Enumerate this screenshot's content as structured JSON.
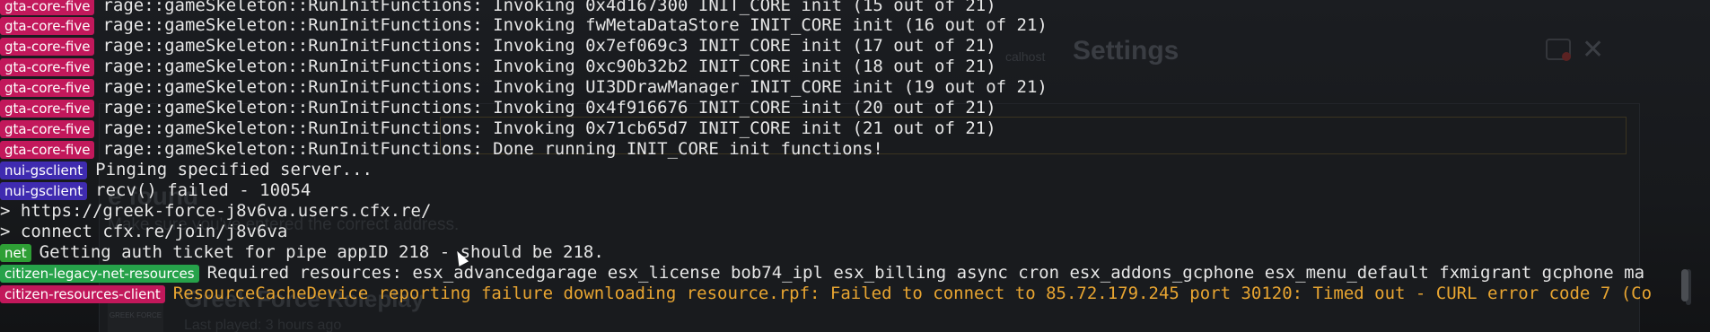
{
  "background": {
    "settings_title": "Settings",
    "localhost_label": "calhost",
    "close_glyph": "✕",
    "not_found_heading": "e found",
    "hint_text": "Make sure you've entered the correct address.",
    "server_name": "Greek Force Roleplay",
    "last_played": "Last played: 3 hours ago",
    "logo_text": "GREEK FORCE"
  },
  "console": {
    "lines": [
      {
        "tag": "gta-core-five",
        "text": "rage::gameSkeleton::RunInitFunctions: Invoking 0x4d167300 INIT_CORE init (15 out of 21)"
      },
      {
        "tag": "gta-core-five",
        "text": "rage::gameSkeleton::RunInitFunctions: Invoking fwMetaDataStore INIT_CORE init (16 out of 21)"
      },
      {
        "tag": "gta-core-five",
        "text": "rage::gameSkeleton::RunInitFunctions: Invoking 0x7ef069c3 INIT_CORE init (17 out of 21)"
      },
      {
        "tag": "gta-core-five",
        "text": "rage::gameSkeleton::RunInitFunctions: Invoking 0xc90b32b2 INIT_CORE init (18 out of 21)"
      },
      {
        "tag": "gta-core-five",
        "text": "rage::gameSkeleton::RunInitFunctions: Invoking UI3DDrawManager INIT_CORE init (19 out of 21)"
      },
      {
        "tag": "gta-core-five",
        "text": "rage::gameSkeleton::RunInitFunctions: Invoking 0x4f916676 INIT_CORE init (20 out of 21)"
      },
      {
        "tag": "gta-core-five",
        "text": "rage::gameSkeleton::RunInitFunctions: Invoking 0x71cb65d7 INIT_CORE init (21 out of 21)"
      },
      {
        "tag": "gta-core-five",
        "text": "rage::gameSkeleton::RunInitFunctions: Done running INIT_CORE init functions!"
      },
      {
        "tag": "nui-gsclient",
        "text": "Pinging specified server..."
      },
      {
        "tag": "nui-gsclient",
        "text": "recv() failed - 10054"
      },
      {
        "tag": "",
        "text": "> https://greek-force-j8v6va.users.cfx.re/"
      },
      {
        "tag": "",
        "text": "> connect cfx.re/join/j8v6va"
      },
      {
        "tag": "net",
        "text": "Getting auth ticket for pipe appID 218 - should be 218."
      },
      {
        "tag": "citizen-legacy-net-resources",
        "text": "Required resources: esx_advancedgarage esx_license bob74_ipl esx_billing async cron esx_addons_gcphone esx_menu_default fxmigrant gcphone ma"
      },
      {
        "tag": "citizen-resources-client",
        "text": "ResourceCacheDevice reporting failure downloading resource.rpf: Failed to connect to 85.72.179.245 port 30120: Timed out - CURL error code 7 (Co"
      }
    ]
  }
}
